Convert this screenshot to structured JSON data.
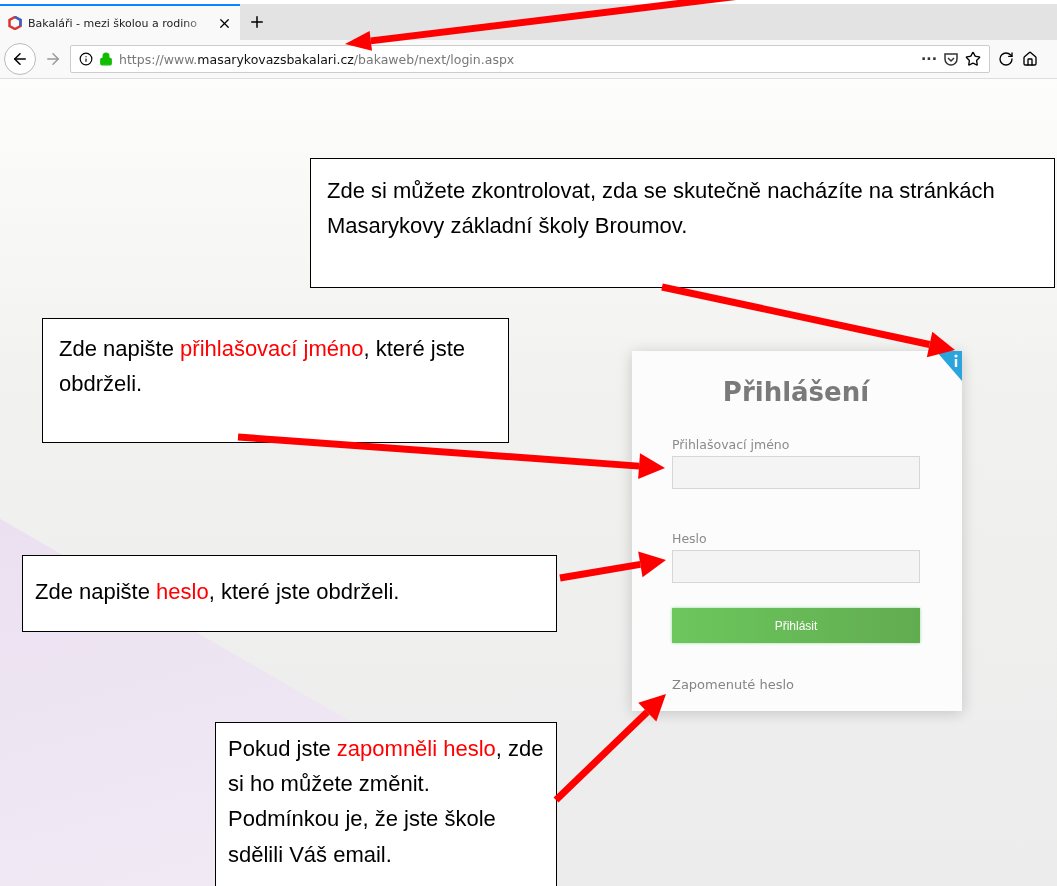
{
  "browser": {
    "tab": {
      "title": "Bakaláři - mezi školou a rodino",
      "selected": true
    },
    "url": {
      "prefix": "https://www.",
      "domain": "masarykovazsbakalari.cz",
      "path": "/bakaweb/next/login.aspx"
    },
    "more": "···"
  },
  "login": {
    "title": "Přihlášení",
    "username_label": "Přihlašovací jméno",
    "password_label": "Heslo",
    "submit": "Přihlásit",
    "forgot": "Zapomenuté heslo"
  },
  "callouts": [
    {
      "segments": [
        {
          "text": "Zde si můžete zkontrolovat, zda se skutečně nacházíte na stránkách Masarykovy základní školy Broumov.",
          "highlight": false
        }
      ]
    },
    {
      "segments": [
        {
          "text": "Zde napište ",
          "highlight": false
        },
        {
          "text": "přihlašovací jméno",
          "highlight": true
        },
        {
          "text": ", které jste obdrželi.",
          "highlight": false
        }
      ]
    },
    {
      "segments": [
        {
          "text": "Zde napište ",
          "highlight": false
        },
        {
          "text": "heslo",
          "highlight": true
        },
        {
          "text": ", které jste obdrželi.",
          "highlight": false
        }
      ]
    },
    {
      "segments": [
        {
          "text": "Pokud jste ",
          "highlight": false
        },
        {
          "text": "zapomněli heslo",
          "highlight": true
        },
        {
          "text": ", zde si ho můžete změnit. Podmínkou je, že jste škole sdělili Váš email.",
          "highlight": false
        }
      ]
    }
  ]
}
